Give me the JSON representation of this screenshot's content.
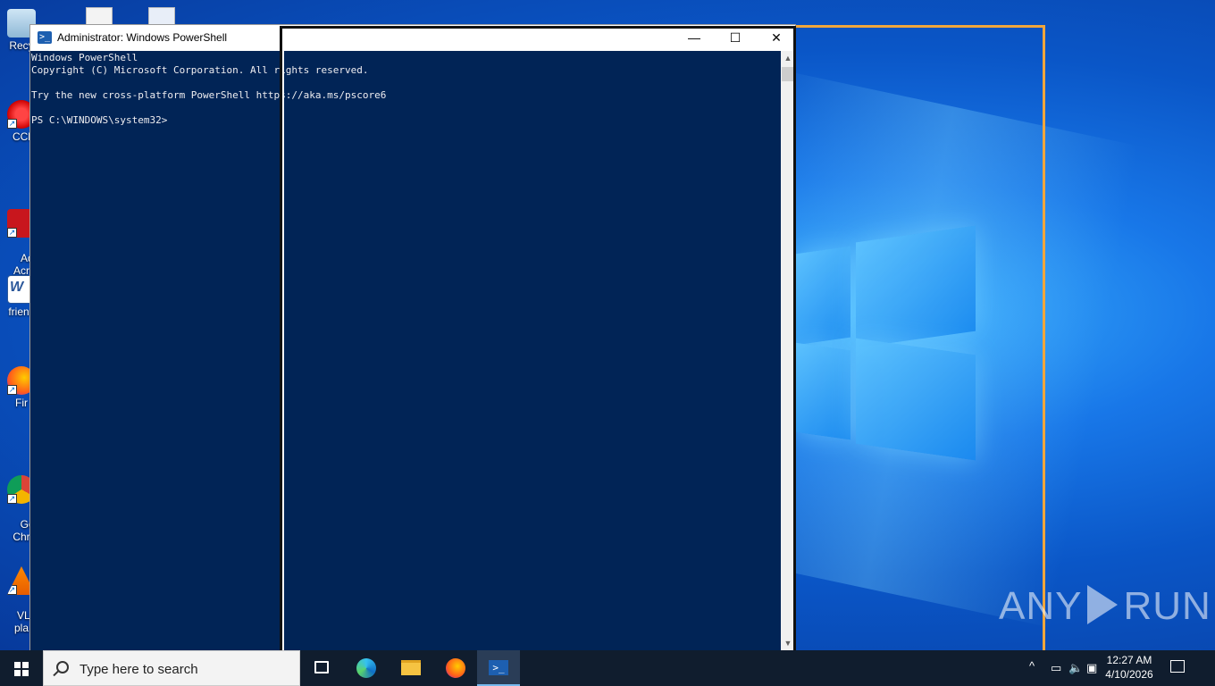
{
  "window": {
    "title": "Administrator: Windows PowerShell",
    "minimize_glyph": "—",
    "maximize_glyph": "☐",
    "close_glyph": "✕"
  },
  "console": {
    "lines": [
      "Windows PowerShell",
      "Copyright (C) Microsoft Corporation. All rights reserved.",
      "",
      "Try the new cross-platform PowerShell https://aka.ms/pscore6",
      "",
      "PS C:\\WINDOWS\\system32>"
    ],
    "background": "#012456",
    "foreground": "#eeedf0"
  },
  "desktop_icons": [
    {
      "name": "recycle-bin",
      "label": "Recy"
    },
    {
      "name": "ccleaner",
      "label": "CCl"
    },
    {
      "name": "adobe-acrobat",
      "label": "Ad\nAcr"
    },
    {
      "name": "word-doc",
      "label": "frienc"
    },
    {
      "name": "firefox",
      "label": "Fir"
    },
    {
      "name": "google-chrome",
      "label": "Go\nChr"
    },
    {
      "name": "vlc",
      "label": "VLC\npla"
    }
  ],
  "taskbar": {
    "search_placeholder": "Type here to search",
    "apps": [
      "task-view",
      "edge",
      "file-explorer",
      "firefox",
      "powershell"
    ],
    "time": "12:27 AM",
    "date": "4/10/2026"
  },
  "watermark": {
    "left": "ANY",
    "right": "RUN"
  },
  "colors": {
    "accent_orange": "#f0a63c",
    "taskbar": "#101d2e"
  }
}
